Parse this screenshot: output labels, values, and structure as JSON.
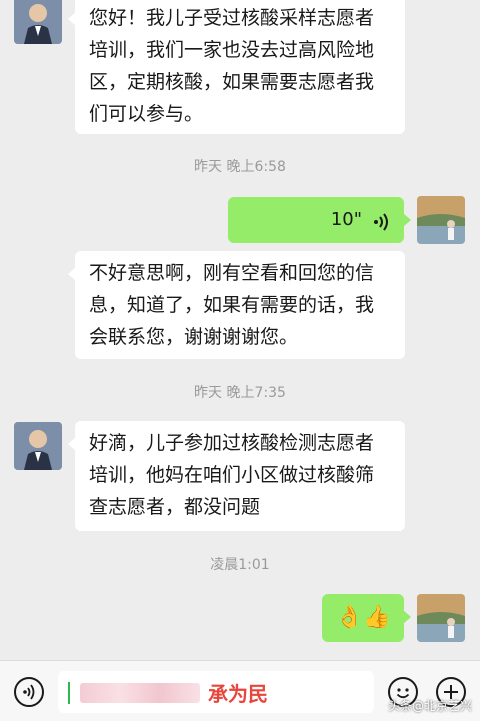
{
  "messages": {
    "m1": "您好！我儿子受过核酸采样志愿者培训，我们一家也没去过高风险地区，定期核酸，如果需要志愿者我们可以参与。",
    "ts1": "昨天 晚上6:58",
    "voice_duration": "10\"",
    "m2": "不好意思啊，刚有空看和回您的信息，知道了，如果有需要的话，我会联系您，谢谢谢谢您。",
    "ts2": "昨天 晚上7:35",
    "m3": "好滴，儿子参加过核酸检测志愿者培训，他妈在咱们小区做过核酸筛查志愿者，都没问题",
    "ts3": "凌晨1:01",
    "emoji_reply": "👌👍"
  },
  "input": {
    "text": "承为民"
  },
  "watermark": "头条@北京艺兴",
  "colors": {
    "background": "#ededed",
    "outgoing_bubble": "#95ec69",
    "incoming_bubble": "#ffffff",
    "input_text": "#e8453c"
  },
  "icons": [
    "voice-icon",
    "emoji-icon",
    "plus-icon",
    "voice-wave-icon"
  ]
}
